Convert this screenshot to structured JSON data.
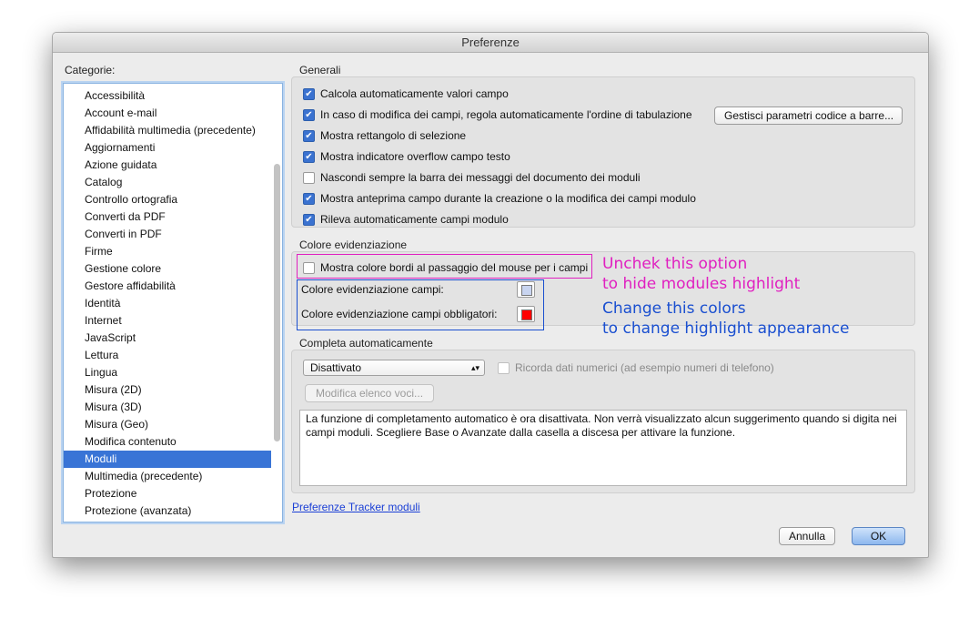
{
  "window": {
    "title": "Preferenze"
  },
  "sidebar": {
    "label": "Categorie:",
    "items": [
      "Accessibilità",
      "Account e-mail",
      "Affidabilità multimedia (precedente)",
      "Aggiornamenti",
      "Azione guidata",
      "Catalog",
      "Controllo ortografia",
      "Converti da PDF",
      "Converti in PDF",
      "Firme",
      "Gestione colore",
      "Gestore affidabilità",
      "Identità",
      "Internet",
      "JavaScript",
      "Lettura",
      "Lingua",
      "Misura (2D)",
      "Misura (3D)",
      "Misura (Geo)",
      "Modifica contenuto",
      "Moduli",
      "Multimedia (precedente)",
      "Protezione",
      "Protezione (avanzata)"
    ],
    "selected": "Moduli"
  },
  "general": {
    "title": "Generali",
    "options": [
      {
        "label": "Calcola automaticamente valori campo",
        "checked": true
      },
      {
        "label": "In caso di modifica dei campi, regola automaticamente l'ordine di tabulazione",
        "checked": true
      },
      {
        "label": "Mostra rettangolo di selezione",
        "checked": true
      },
      {
        "label": "Mostra indicatore overflow campo testo",
        "checked": true
      },
      {
        "label": "Nascondi sempre la barra dei messaggi del documento dei moduli",
        "checked": false
      },
      {
        "label": "Mostra anteprima campo durante la creazione o la modifica dei campi modulo",
        "checked": true
      },
      {
        "label": "Rileva automaticamente campi modulo",
        "checked": true
      }
    ],
    "barcode_button": "Gestisci parametri codice a barre..."
  },
  "highlight": {
    "title": "Colore evidenziazione",
    "mouseover_label": "Mostra colore bordi al passaggio del mouse per i campi",
    "mouseover_checked": false,
    "fields_label": "Colore evidenziazione campi:",
    "fields_color": "#c8d4f0",
    "required_label": "Colore evidenziazione campi obbligatori:",
    "required_color": "#ff0000"
  },
  "annotations": {
    "uncheck_line1": "Unchek this option",
    "uncheck_line2": "to hide modules highlight",
    "uncheck_color": "#e020c0",
    "change_line1": "Change this colors",
    "change_line2": "to change highlight appearance",
    "change_color": "#1a4fd0"
  },
  "autocomplete": {
    "title": "Completa automaticamente",
    "select_value": "Disattivato",
    "remember_label": "Ricorda dati numerici (ad esempio numeri di telefono)",
    "remember_checked": false,
    "edit_button": "Modifica elenco voci...",
    "description": "La funzione di completamento automatico è ora disattivata. Non verrà visualizzato alcun suggerimento quando si digita nei campi moduli. Scegliere Base o Avanzate dalla casella a discesa per attivare la funzione."
  },
  "footer": {
    "tracker_link": "Preferenze Tracker moduli",
    "cancel_button": "Annulla",
    "ok_button": "OK"
  }
}
